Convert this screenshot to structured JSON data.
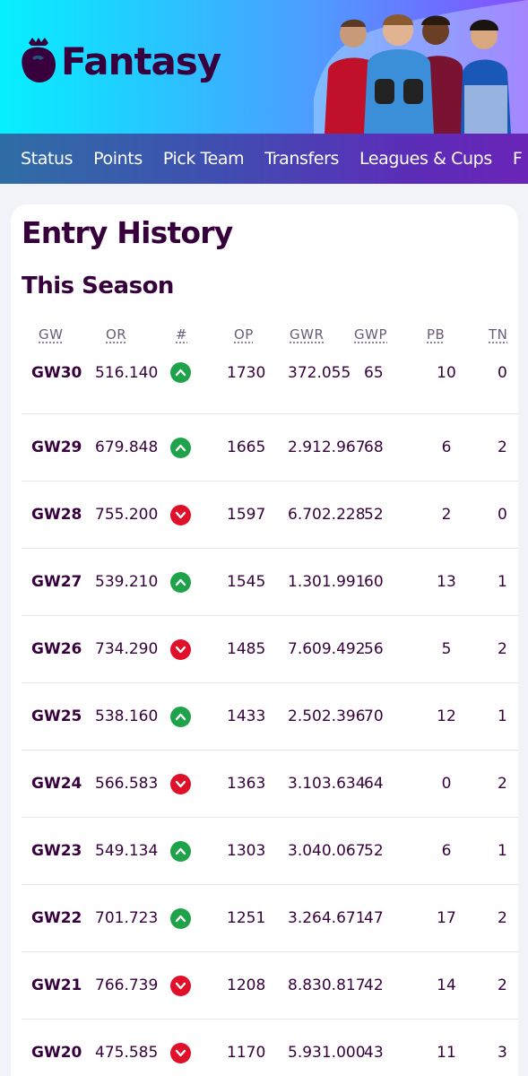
{
  "app": {
    "brand": "Fantasy",
    "accent": "#37003c",
    "up_color": "#1fa34a",
    "down_color": "#e0102b"
  },
  "nav": {
    "items": [
      "Status",
      "Points",
      "Pick Team",
      "Transfers",
      "Leagues & Cups",
      "F"
    ]
  },
  "page": {
    "title": "Entry History",
    "section": "This Season"
  },
  "table": {
    "columns": [
      "GW",
      "OR",
      "#",
      "OP",
      "GWR",
      "GWP",
      "PB",
      "TM"
    ],
    "columns_visible": [
      "GW",
      "OR",
      "#",
      "OP",
      "GWR",
      "GWP",
      "PB",
      "TN"
    ],
    "rows": [
      {
        "gw": "GW30",
        "or": "516.140",
        "dir": "up",
        "op": "1730",
        "gwr": "372.055",
        "gwp": "65",
        "pb": "10",
        "tm": "0"
      },
      {
        "gw": "GW29",
        "or": "679.848",
        "dir": "up",
        "op": "1665",
        "gwr": "2.912.967",
        "gwp": "68",
        "pb": "6",
        "tm": "2"
      },
      {
        "gw": "GW28",
        "or": "755.200",
        "dir": "down",
        "op": "1597",
        "gwr": "6.702.228",
        "gwp": "52",
        "pb": "2",
        "tm": "0"
      },
      {
        "gw": "GW27",
        "or": "539.210",
        "dir": "up",
        "op": "1545",
        "gwr": "1.301.991",
        "gwp": "60",
        "pb": "13",
        "tm": "1"
      },
      {
        "gw": "GW26",
        "or": "734.290",
        "dir": "down",
        "op": "1485",
        "gwr": "7.609.492",
        "gwp": "56",
        "pb": "5",
        "tm": "2"
      },
      {
        "gw": "GW25",
        "or": "538.160",
        "dir": "up",
        "op": "1433",
        "gwr": "2.502.396",
        "gwp": "70",
        "pb": "12",
        "tm": "1"
      },
      {
        "gw": "GW24",
        "or": "566.583",
        "dir": "down",
        "op": "1363",
        "gwr": "3.103.634",
        "gwp": "64",
        "pb": "0",
        "tm": "2"
      },
      {
        "gw": "GW23",
        "or": "549.134",
        "dir": "up",
        "op": "1303",
        "gwr": "3.040.067",
        "gwp": "52",
        "pb": "6",
        "tm": "1"
      },
      {
        "gw": "GW22",
        "or": "701.723",
        "dir": "up",
        "op": "1251",
        "gwr": "3.264.671",
        "gwp": "47",
        "pb": "17",
        "tm": "2"
      },
      {
        "gw": "GW21",
        "or": "766.739",
        "dir": "down",
        "op": "1208",
        "gwr": "8.830.817",
        "gwp": "42",
        "pb": "14",
        "tm": "2"
      },
      {
        "gw": "GW20",
        "or": "475.585",
        "dir": "down",
        "op": "1170",
        "gwr": "5.931.000",
        "gwp": "43",
        "pb": "11",
        "tm": "3"
      }
    ]
  }
}
